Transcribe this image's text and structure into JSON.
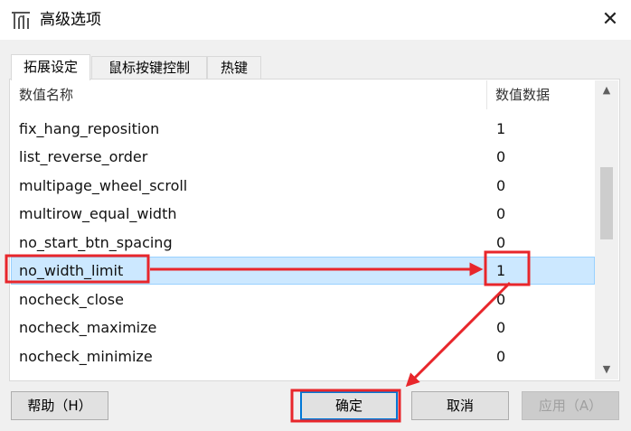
{
  "window": {
    "title": "高级选项",
    "icon": "app-logo-icon",
    "close_symbol": "✕"
  },
  "tabs": [
    {
      "label": "拓展设定",
      "active": true
    },
    {
      "label": "鼠标按键控制",
      "active": false
    },
    {
      "label": "热键",
      "active": false
    }
  ],
  "table": {
    "headers": {
      "name": "数值名称",
      "value": "数值数据"
    },
    "rows": [
      {
        "name": "fix_hang_reposition",
        "value": "1"
      },
      {
        "name": "list_reverse_order",
        "value": "0"
      },
      {
        "name": "multipage_wheel_scroll",
        "value": "0"
      },
      {
        "name": "multirow_equal_width",
        "value": "0"
      },
      {
        "name": "no_start_btn_spacing",
        "value": "0"
      },
      {
        "name": "no_width_limit",
        "value": "1",
        "selected": true
      },
      {
        "name": "nocheck_close",
        "value": "0"
      },
      {
        "name": "nocheck_maximize",
        "value": "0"
      },
      {
        "name": "nocheck_minimize",
        "value": "0"
      }
    ]
  },
  "buttons": {
    "help": "帮助（H）",
    "ok": "确定",
    "cancel": "取消",
    "apply": "应用（A）"
  },
  "colors": {
    "selection_bg": "#cce8ff",
    "annotation_red": "#e8262b",
    "default_button_border": "#0078d7"
  }
}
